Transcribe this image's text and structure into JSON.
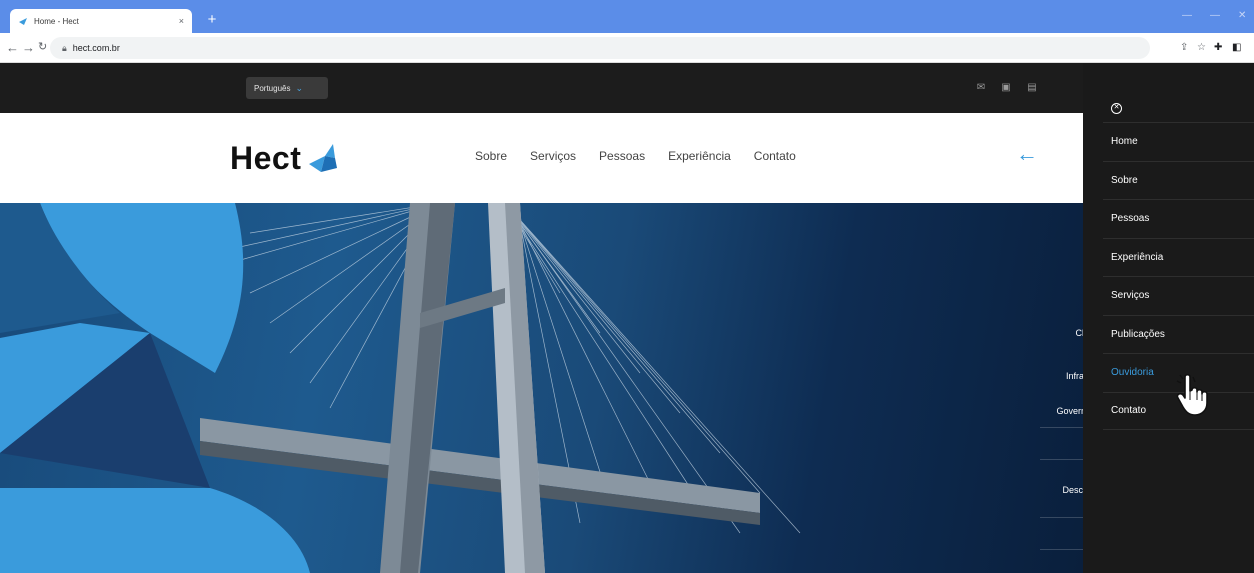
{
  "browser": {
    "tab_title": "Home - Hect",
    "tab_close": "×",
    "new_tab": "+",
    "url": "hect.com.br"
  },
  "topbar": {
    "language": "Português"
  },
  "header": {
    "logo_text": "Hect",
    "nav": [
      "Sobre",
      "Serviços",
      "Pessoas",
      "Experiência",
      "Contato"
    ]
  },
  "hero": {
    "lines": [
      "Clai",
      "Infrast",
      "Governa",
      "Descor"
    ]
  },
  "side_menu": {
    "items": [
      "Home",
      "Sobre",
      "Pessoas",
      "Experiência",
      "Serviços",
      "Publicações",
      "Ouvidoria",
      "Contato"
    ],
    "active_index": 6
  },
  "colors": {
    "accent": "#3a9bdc",
    "chrome_tab_strip": "#5b8de8",
    "top_bar": "#1c1c1c",
    "panel": "#1a1a1a"
  }
}
